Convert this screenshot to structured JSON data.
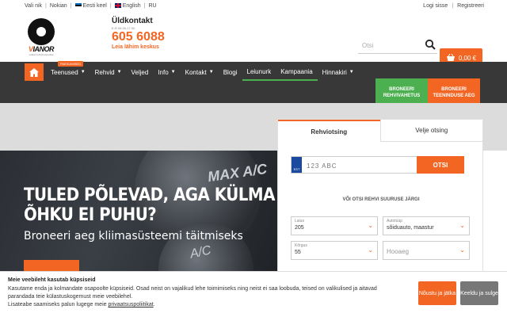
{
  "topbar": {
    "left_links": [
      "Vali nik",
      "Nokian"
    ],
    "languages": [
      "Eesti keel",
      "English",
      "RU"
    ],
    "right_links": [
      "Logi sisse",
      "Registreeri"
    ]
  },
  "header": {
    "logo_text": "VIANOR",
    "logo_tagline": "nokian rehvid expertise",
    "contact_title": "Üldkontakt",
    "contact_hours": "E-R 08.30-17.00",
    "phone": "605 6088",
    "nearest_link": "Leia lähim keskus",
    "search_placeholder": "Otsi",
    "cart_total": "0,00 €"
  },
  "nav": {
    "badge": "PAKKUMISED",
    "items": [
      {
        "label": "Teenused",
        "dropdown": true
      },
      {
        "label": "Rehvid",
        "dropdown": true
      },
      {
        "label": "Veljed",
        "dropdown": false
      },
      {
        "label": "Info",
        "dropdown": true
      },
      {
        "label": "Kontakt",
        "dropdown": true
      },
      {
        "label": "Blogi",
        "dropdown": false
      },
      {
        "label": "Leiunurk",
        "dropdown": false
      },
      {
        "label": "Kampaania",
        "dropdown": false
      },
      {
        "label": "Hinnakiri",
        "dropdown": true
      }
    ],
    "book_tire": "Broneeri rehvivahetus",
    "book_service": "Broneeri teeninduse aeg"
  },
  "hero": {
    "headline": "TULED PÕLEVAD, AGA KÜLMA ÕHKU EI PUHU?",
    "subheadline": "Broneeri aeg kliimasüsteemi täitmiseks",
    "dash_label_1": "MAX A/C",
    "dash_label_2": "A/C"
  },
  "search_panel": {
    "tab_tires": "Rehviotsing",
    "tab_rims": "Velje otsing",
    "plate_country": "EST",
    "plate_placeholder": "123 ABC",
    "plate_button": "OTSI",
    "or_text": "VÕI OTSI REHVI SUURUSE JÄRGI",
    "fields": [
      {
        "label": "Laius",
        "value": "205"
      },
      {
        "label": "Autotüüp",
        "value": "sõiduauto, maastur"
      },
      {
        "label": "Kõrgus",
        "value": "55"
      },
      {
        "label": "",
        "placeholder": "Hooaeg"
      }
    ]
  },
  "cookie": {
    "title": "Meie veebileht kasutab küpsiseid",
    "text": "Kasutame enda ja kolmandate osapoolte küpsiseid. Osad neist on vajalikud lehe toimimiseks ning neist ei saa loobuda, teised on valikulised ja aitavad parandada teie külastuskogemust meie veebilehel.",
    "more_prefix": "Lisateabe saamiseks palun lugege meie ",
    "policy_link": "privaatsuspoliitikat",
    "accept": "Nõustu ja jätka",
    "decline": "Keeldu ja sulge"
  },
  "colors": {
    "accent": "#f26522",
    "nav_bg": "#383838",
    "green": "#4caf50"
  }
}
